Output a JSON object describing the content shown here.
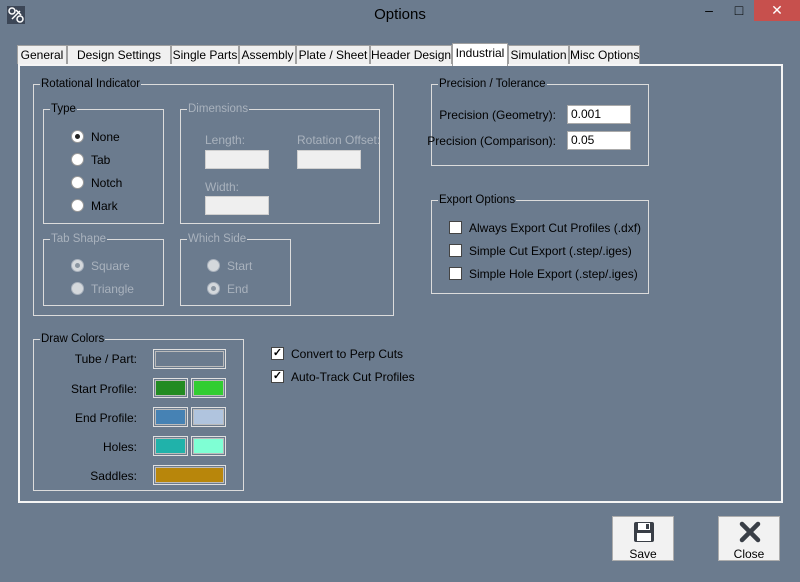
{
  "window": {
    "title": "Options",
    "minimize": "‒",
    "maximize": "□",
    "close": "✕"
  },
  "tabs": [
    "General",
    "Design Settings",
    "Single Parts",
    "Assembly",
    "Plate / Sheet",
    "Header Design",
    "Industrial",
    "Simulation",
    "Misc Options"
  ],
  "active_tab": "Industrial",
  "rotational_indicator": {
    "label": "Rotational Indicator",
    "type": {
      "label": "Type",
      "options": [
        "None",
        "Tab",
        "Notch",
        "Mark"
      ],
      "selected": "None"
    },
    "dimensions": {
      "label": "Dimensions",
      "length_label": "Length:",
      "rotation_offset_label": "Rotation Offset:",
      "width_label": "Width:",
      "length_value": "",
      "rotation_offset_value": "",
      "width_value": ""
    },
    "tab_shape": {
      "label": "Tab Shape",
      "options": [
        "Square",
        "Triangle"
      ],
      "selected": "Square"
    },
    "which_side": {
      "label": "Which Side",
      "options": [
        "Start",
        "End"
      ],
      "selected": "End"
    }
  },
  "precision": {
    "label": "Precision / Tolerance",
    "geometry_label": "Precision (Geometry):",
    "geometry_value": "0.001",
    "comparison_label": "Precision (Comparison):",
    "comparison_value": "0.05"
  },
  "export_options": {
    "label": "Export Options",
    "items": [
      {
        "label": "Always Export Cut Profiles (.dxf)",
        "checked": false
      },
      {
        "label": "Simple Cut Export (.step/.iges)",
        "checked": false
      },
      {
        "label": "Simple Hole Export (.step/.iges)",
        "checked": false
      }
    ]
  },
  "draw_colors": {
    "label": "Draw Colors",
    "rows": [
      {
        "label": "Tube / Part:",
        "colors": [
          "#6b7b8e"
        ]
      },
      {
        "label": "Start Profile:",
        "colors": [
          "#228b22",
          "#32cd32"
        ]
      },
      {
        "label": "End Profile:",
        "colors": [
          "#4682b4",
          "#b0c4de"
        ]
      },
      {
        "label": "Holes:",
        "colors": [
          "#20b2aa",
          "#7fffd4"
        ]
      },
      {
        "label": "Saddles:",
        "colors": [
          "#b8860b"
        ]
      }
    ]
  },
  "options": [
    {
      "label": "Convert to Perp Cuts",
      "checked": true
    },
    {
      "label": "Auto-Track Cut Profiles",
      "checked": true
    }
  ],
  "buttons": {
    "save": "Save",
    "close": "Close"
  }
}
